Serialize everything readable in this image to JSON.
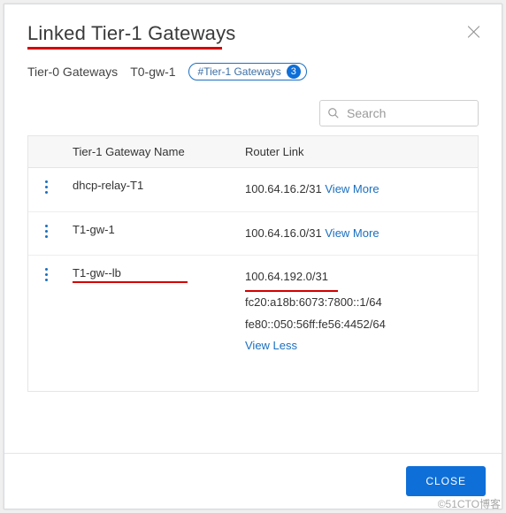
{
  "header": {
    "title": "Linked Tier-1 Gateways",
    "close_aria": "Close"
  },
  "breadcrumb": {
    "root": "Tier-0 Gateways",
    "gw": "T0-gw-1",
    "chip_label": "#Tier-1 Gateways",
    "chip_count": "3"
  },
  "search": {
    "placeholder": "Search"
  },
  "table": {
    "columns": {
      "name": "Tier-1 Gateway Name",
      "link": "Router Link"
    },
    "rows": [
      {
        "name": "dhcp-relay-T1",
        "addresses": [
          "100.64.16.2/31"
        ],
        "toggle_label": "View More",
        "expanded": false,
        "highlighted": false
      },
      {
        "name": "T1-gw-1",
        "addresses": [
          "100.64.16.0/31"
        ],
        "toggle_label": "View More",
        "expanded": false,
        "highlighted": false
      },
      {
        "name": "T1-gw--lb",
        "addresses": [
          "100.64.192.0/31",
          "fc20:a18b:6073:7800::1/64",
          "fe80::050:56ff:fe56:4452/64"
        ],
        "toggle_label": "View Less",
        "expanded": true,
        "highlighted": true
      }
    ]
  },
  "footer": {
    "close_label": "CLOSE"
  },
  "watermark": "©51CTO博客"
}
